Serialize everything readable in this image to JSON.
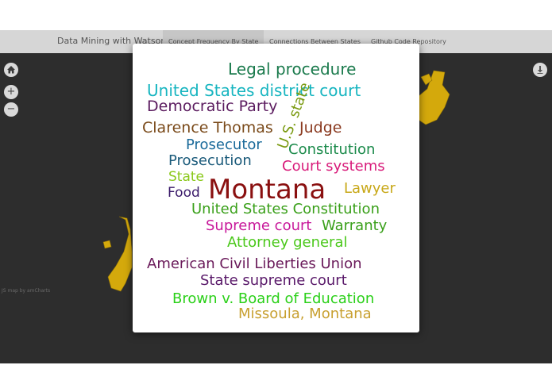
{
  "header": {
    "brand": "Data Mining with Watson",
    "tabs": [
      {
        "label": "Concept Frequency By State"
      },
      {
        "label": "Connections Between States"
      },
      {
        "label": "Github Code Repository"
      }
    ]
  },
  "map": {
    "credit": "JS map by amCharts",
    "region_color": "#d4a90c",
    "controls": {
      "zoom_in": "+",
      "zoom_out": "−"
    }
  },
  "word_cloud": {
    "words": [
      {
        "text": "Legal procedure",
        "color": "#1a7a4c"
      },
      {
        "text": "United States district court",
        "color": "#17b5c0"
      },
      {
        "text": "Democratic Party",
        "color": "#5a1a5e"
      },
      {
        "text": "U.S. state",
        "color": "#7a9a10"
      },
      {
        "text": "Clarence Thomas",
        "color": "#7a4a1a"
      },
      {
        "text": "Judge",
        "color": "#8a3a20"
      },
      {
        "text": "Prosecutor",
        "color": "#1a6a9a"
      },
      {
        "text": "Constitution",
        "color": "#1a8a4a"
      },
      {
        "text": "Prosecution",
        "color": "#1a5a7a"
      },
      {
        "text": "Court systems",
        "color": "#d81b7a"
      },
      {
        "text": "State",
        "color": "#8ac81a"
      },
      {
        "text": "Food",
        "color": "#3a1a6a"
      },
      {
        "text": "Montana",
        "color": "#8a1010"
      },
      {
        "text": "Lawyer",
        "color": "#c8a818"
      },
      {
        "text": "United States Constitution",
        "color": "#3aa01a"
      },
      {
        "text": "Supreme court",
        "color": "#c8189a"
      },
      {
        "text": "Warranty",
        "color": "#3aa01a"
      },
      {
        "text": "Attorney general",
        "color": "#4ac81a"
      },
      {
        "text": "American Civil Liberties Union",
        "color": "#6a1a5a"
      },
      {
        "text": "State supreme court",
        "color": "#5a1a6a"
      },
      {
        "text": "Brown v. Board of Education",
        "color": "#2ad018"
      },
      {
        "text": "Missoula, Montana",
        "color": "#c8a030"
      }
    ]
  }
}
